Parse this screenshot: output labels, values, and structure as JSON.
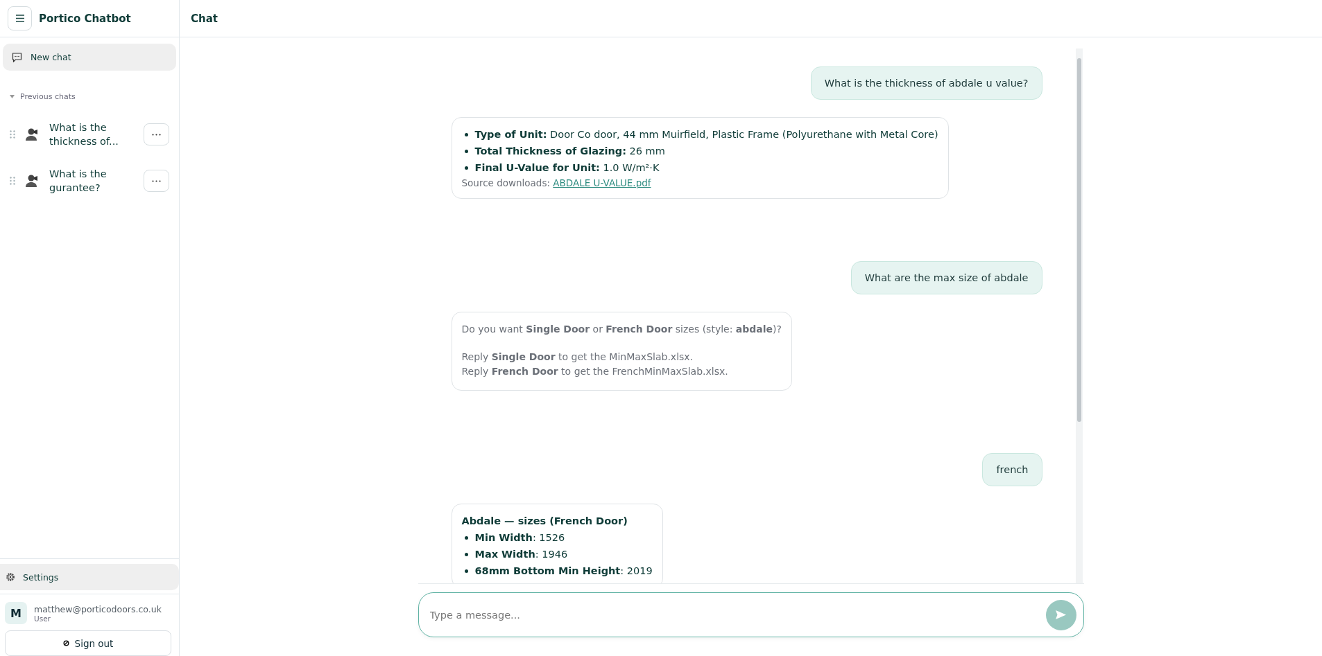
{
  "sidebar": {
    "title": "Portico Chatbot",
    "new_chat": "New chat",
    "section": {
      "label": "Previous chats",
      "expanded": true
    },
    "chats": [
      {
        "title": "What is the thickness of..."
      },
      {
        "title": "What is the gurantee?"
      }
    ],
    "settings": "Settings",
    "user": {
      "initial": "M",
      "email": "matthew@porticodoors.co.uk",
      "role": "User"
    },
    "sign_out": "Sign out"
  },
  "header": {
    "title": "Chat"
  },
  "messages": [
    {
      "kind": "user",
      "text": "What is the thickness of abdale u value?"
    },
    {
      "kind": "bot",
      "muted": false,
      "blocks": [
        {
          "kind": "bullet",
          "text": "**Type of Unit:** Door Co door, 44 mm Muirfield, Plastic Frame (Polyurethane with Metal Core)"
        },
        {
          "kind": "bullet",
          "text": "**Total Thickness of Glazing:** 26 mm"
        },
        {
          "kind": "bullet",
          "text": "**Final U-Value for Unit:** 1.0 W/m²·K"
        },
        {
          "kind": "source",
          "text": "Source downloads: ",
          "link": "ABDALE U-VALUE.pdf"
        }
      ]
    },
    {
      "kind": "user",
      "text": "What are the max size of abdale"
    },
    {
      "kind": "bot",
      "muted": true,
      "blocks": [
        {
          "kind": "paragraph",
          "text": "Do you want **Single Door** or **French Door** sizes (style: **abdale**)?"
        },
        {
          "kind": "spacer"
        },
        {
          "kind": "paragraph",
          "text": "Reply **Single Door** to get the MinMaxSlab.xlsx."
        },
        {
          "kind": "paragraph",
          "text": "Reply **French Door** to get the FrenchMinMaxSlab.xlsx."
        }
      ]
    },
    {
      "kind": "user",
      "text": "french"
    },
    {
      "kind": "bot",
      "muted": false,
      "blocks": [
        {
          "kind": "heading",
          "text": "Abdale — sizes (French Door)"
        },
        {
          "kind": "bullet",
          "text": "**Min Width**: 1526"
        },
        {
          "kind": "bullet",
          "text": "**Max Width**: 1946"
        },
        {
          "kind": "bullet",
          "text": "**68mm Bottom Min Height**: 2019"
        }
      ]
    }
  ],
  "composer": {
    "placeholder": "Type a message..."
  }
}
